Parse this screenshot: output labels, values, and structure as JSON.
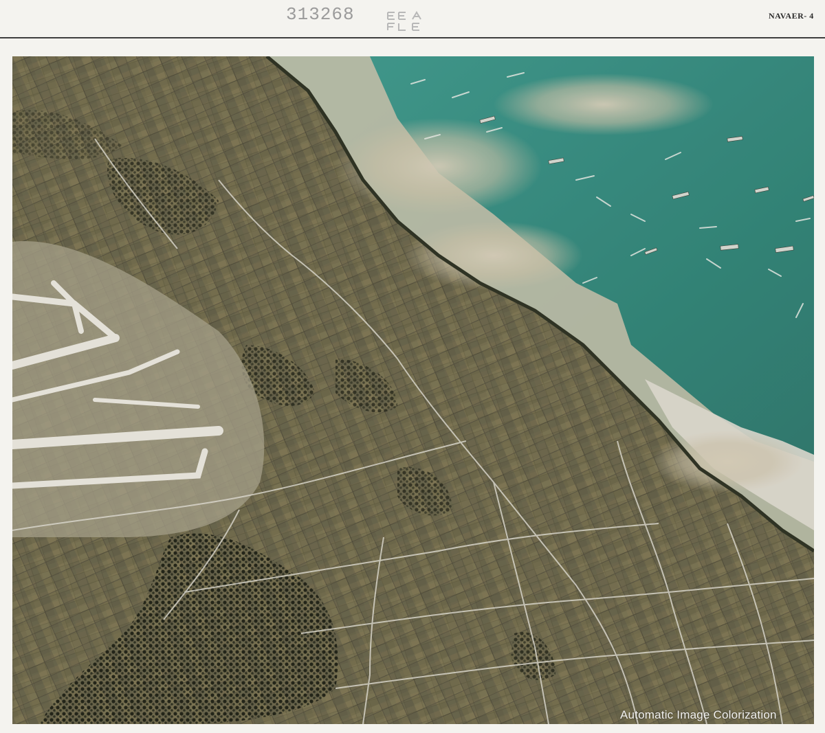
{
  "header": {
    "serial_number": "313268",
    "doc_code": "NAVAER- 4"
  },
  "watermark": {
    "text": "Automatic Image Colorization"
  },
  "colors": {
    "sea": "#3f9e95",
    "shallow_water": "#cbc6b4",
    "land": "#6f6a48",
    "dense_vegetation": "#1f2318",
    "airfield": "#e6e6e1",
    "page": "#f4f3ef"
  }
}
